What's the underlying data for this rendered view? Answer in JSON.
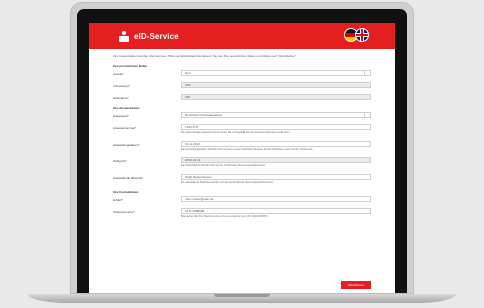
{
  "app": {
    "title": "eID-Service"
  },
  "language": {
    "de_icon": "flag-de-icon",
    "en_icon": "flag-gb-icon"
  },
  "intro": "Ihre Ausweisdaten wurden übernommen. Bitte vervollständigen/korrigieren Sie nun Ihre persönlichen Daten und klicken auf \"Abschließen\".",
  "sections": {
    "personal": "Ihre persönlichen Daten",
    "document": "Ihre Ausweisdaten",
    "contact": "Ihre Kontaktdaten"
  },
  "fields": {
    "anrede": {
      "label": "Anrede*",
      "value": "Herr"
    },
    "vorname": {
      "label": "Vorname(n)*",
      "value": "Willi"
    },
    "nachname": {
      "label": "Nachname*",
      "value": "Kliff"
    },
    "ausweisart": {
      "label": "Ausweisart*",
      "value": "Deutscher Personalausweis"
    },
    "ausweisnummer": {
      "label": "Ausweisnummer*",
      "value": "T01XJ7JT",
      "hint": "Die siebenstellige Ausweisnummer finden Sie im Regelfall auf der Ausweisvorderseite rechts oben."
    },
    "ausstellungsdatum": {
      "label": "Ausstellungsdatum*",
      "value": "01.11.2010",
      "hint": "Das Ausstellungsdatum befindet sich bei einem neuen deutschen Ausweis auf der Rückseite, sonst auf der Vorderseite."
    },
    "gueltig": {
      "label": "Gültig bis*",
      "value": "2030-10-31",
      "hint": "Das Ablaufdatum befindet sich auf der Vorderseite Ihres Ausweisdokuments."
    },
    "behoerde": {
      "label": "Ausstellende Behörde*",
      "value": "Stadt Musterhausen",
      "hint": "Die ausstellende Behörde befindet sich auf der Rückseite Ihres Ausweisdokuments."
    },
    "email": {
      "label": "E-Mail*",
      "value": "max.muster@web.de"
    },
    "telefon": {
      "label": "Telefonnummer*",
      "value": "0171 2385588",
      "hint": "Bitte geben Sie Ihre Telefonnummer ohne Leerzeichen an (z.B. 01601234567)."
    }
  },
  "submit_label": "Abschließen"
}
